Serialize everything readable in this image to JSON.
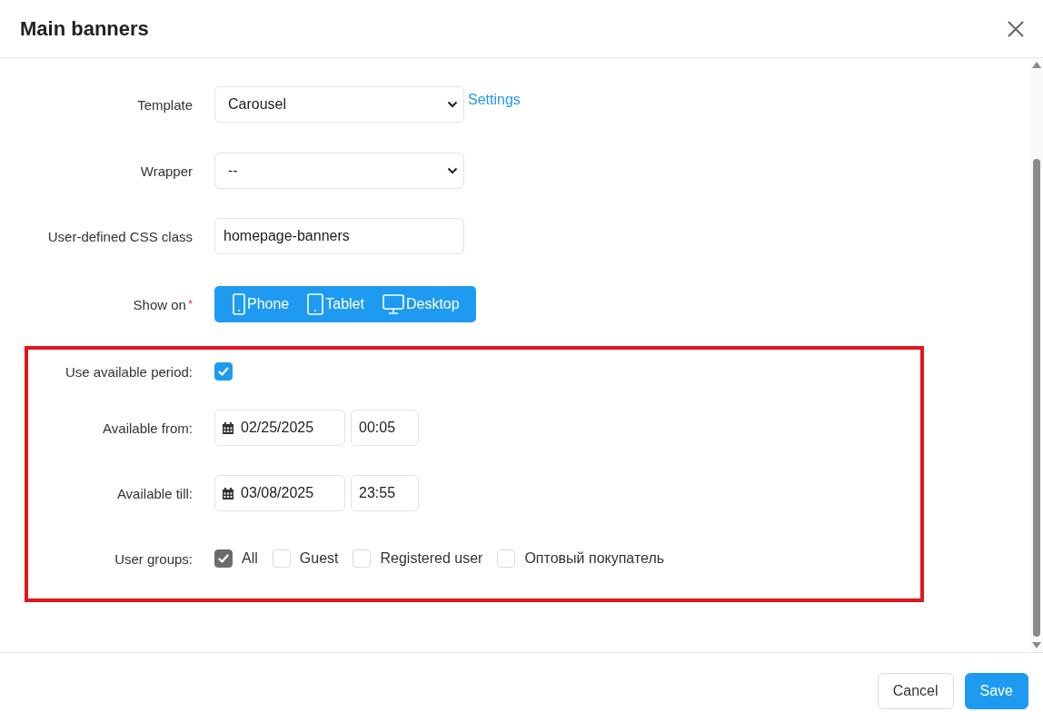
{
  "dialog": {
    "title": "Main banners"
  },
  "fields": [
    {
      "kind": "select",
      "label": "Template",
      "value": "Carousel",
      "link": "Settings"
    },
    {
      "kind": "select",
      "label": "Wrapper",
      "value": "--"
    },
    {
      "kind": "input",
      "label": "User-defined CSS class",
      "value": "homepage-banners"
    },
    {
      "kind": "devices",
      "label": "Show on",
      "required_mark": "*",
      "options": [
        {
          "label": "Phone"
        },
        {
          "label": "Tablet"
        },
        {
          "label": "Desktop"
        }
      ]
    }
  ],
  "period": [
    {
      "kind": "checkbox",
      "label": "Use available period:",
      "checked": true
    },
    {
      "kind": "datetime",
      "label": "Available from:",
      "date": "02/25/2025",
      "time": "00:05"
    },
    {
      "kind": "datetime",
      "label": "Available till:",
      "date": "03/08/2025",
      "time": "23:55"
    },
    {
      "kind": "groups",
      "label": "User groups:",
      "options": [
        {
          "label": "All",
          "checked": true
        },
        {
          "label": "Guest",
          "checked": false
        },
        {
          "label": "Registered user",
          "checked": false
        },
        {
          "label": "Оптовый покупатель",
          "checked": false
        }
      ]
    }
  ],
  "buttons": [
    {
      "kind": "secondary",
      "label": "Cancel"
    },
    {
      "kind": "primary",
      "label": "Save"
    }
  ]
}
